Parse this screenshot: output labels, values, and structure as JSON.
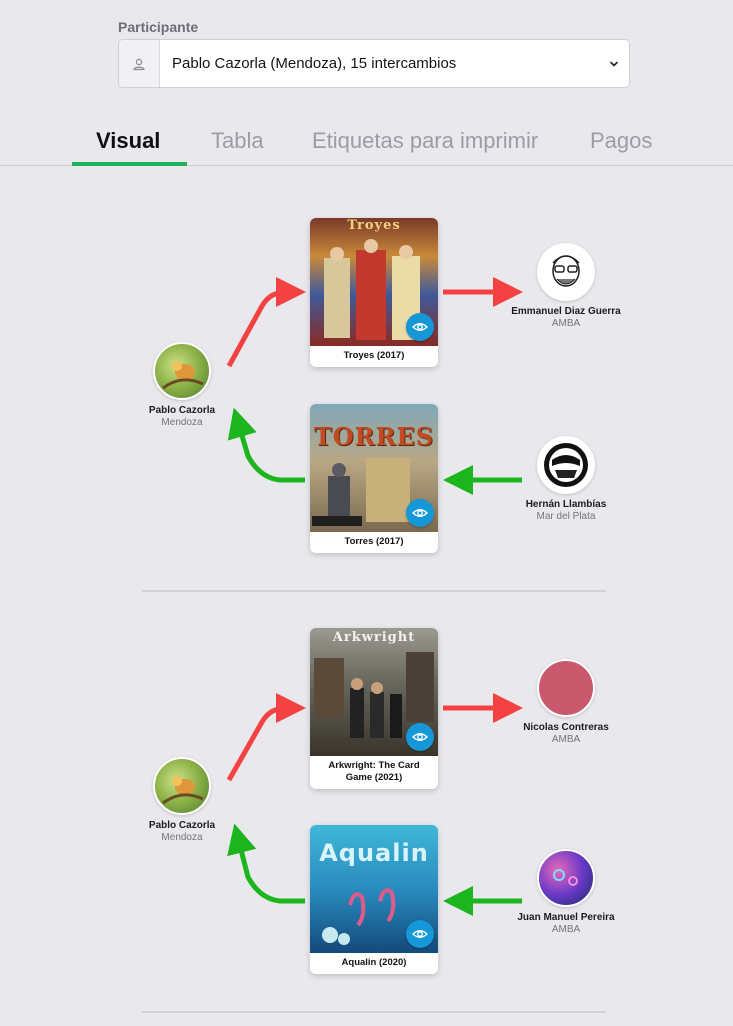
{
  "participant": {
    "label": "Participante",
    "selected": "Pablo Cazorla (Mendoza), 15 intercambios",
    "icon": "user-icon",
    "caret_icon": "chevron-down-icon"
  },
  "tabs": [
    {
      "label": "Visual",
      "active": true
    },
    {
      "label": "Tabla",
      "active": false
    },
    {
      "label": "Etiquetas para imprimir",
      "active": false
    },
    {
      "label": "Pagos",
      "active": false
    }
  ],
  "colors": {
    "accent": "#1fb25a",
    "send_arrow": "#f44242",
    "receive_arrow": "#1db51d",
    "eye_button": "#1597d8"
  },
  "exchanges": [
    {
      "self": {
        "name": "Pablo Cazorla",
        "location": "Mendoza"
      },
      "gives": {
        "game": "Troyes (2017)",
        "cover_text": "Troyes"
      },
      "to": {
        "name": "Emmanuel Diaz Guerra",
        "location": "AMBA"
      },
      "receives": {
        "game": "Torres (2017)",
        "cover_text": "TORRES"
      },
      "from": {
        "name": "Hernán Llambías",
        "location": "Mar del Plata"
      }
    },
    {
      "self": {
        "name": "Pablo Cazorla",
        "location": "Mendoza"
      },
      "gives": {
        "game": "Arkwright: The Card Game (2021)",
        "cover_text": "Arkwright"
      },
      "to": {
        "name": "Nicolas Contreras",
        "location": "AMBA"
      },
      "receives": {
        "game": "Aqualin (2020)",
        "cover_text": "Aqualin"
      },
      "from": {
        "name": "Juan Manuel Pereira",
        "location": "AMBA"
      }
    }
  ]
}
